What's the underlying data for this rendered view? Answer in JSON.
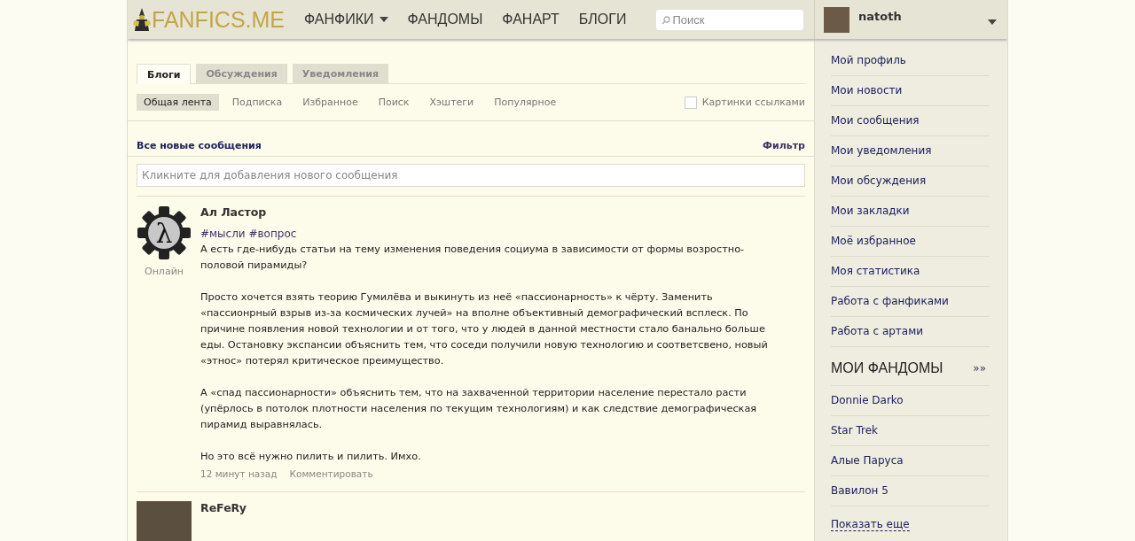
{
  "header": {
    "logo": "FANFICS.ME",
    "nav": [
      {
        "label": "ФАНФИКИ",
        "dropdown": true
      },
      {
        "label": "ФАНДОМЫ",
        "dropdown": false
      },
      {
        "label": "ФАНАРТ",
        "dropdown": false
      },
      {
        "label": "БЛОГИ",
        "dropdown": false
      }
    ],
    "search": {
      "placeholder": "Поиск"
    },
    "user": {
      "name": "natoth"
    }
  },
  "tabs": [
    {
      "label": "Блоги",
      "selected": true
    },
    {
      "label": "Обсуждения",
      "selected": false
    },
    {
      "label": "Уведомления",
      "selected": false
    }
  ],
  "subtabs": [
    {
      "label": "Общая лента",
      "selected": true
    },
    {
      "label": "Подписка",
      "selected": false
    },
    {
      "label": "Избранное",
      "selected": false
    },
    {
      "label": "Поиск",
      "selected": false
    },
    {
      "label": "Хэштеги",
      "selected": false
    },
    {
      "label": "Популярное",
      "selected": false
    }
  ],
  "images_as_links": {
    "label": "Картинки ссылками",
    "checked": false
  },
  "feed": {
    "title": "Все новые сообщения",
    "filter": "Фильтр",
    "new_post": {
      "placeholder": "Кликните для добавления нового сообщения"
    }
  },
  "posts": [
    {
      "author": "Ал Ластор",
      "avatar_symbol": "λ",
      "status": "Онлайн",
      "tags": "#мысли #вопрос",
      "paragraphs": [
        "А есть где-нибудь статьи на тему изменения поведения социума в зависимости от формы возростно-половой пирамиды?",
        "Просто хочется взять теорию Гумилёва и выкинуть из неё «пассионарность» к чёрту. Заменить «пассионрный взрыв из-за космических лучей» на вполне объективный демографический всплеск. По причине появления новой технологии и от того, что у людей в данной местности стало банально больше еды. Остановку экспансии объяснить тем, что соседи получили новую технологию и соответсвено, новый «этнос» потерял критическое преимущество.",
        "А «спад пассионарности» объяснить тем, что на захваченной территории население перестало расти (упёрлось в потолок плотности населения по текущим технологиям) и как следствие демографическая пирамид выравнялась.",
        "Но это всё нужно пилить и пилить. Имхо."
      ],
      "time": "12 минут назад",
      "comment": "Комментировать"
    },
    {
      "author": "ReFeRy"
    }
  ],
  "sidebar": {
    "links": [
      "Мой профиль",
      "Мои новости",
      "Мои сообщения",
      "Мои уведомления",
      "Мои обсуждения",
      "Мои закладки",
      "Моё избранное",
      "Моя статистика",
      "Работа с фанфиками",
      "Работа с артами"
    ],
    "fandoms_title": "МОИ ФАНДОМЫ",
    "fandoms_more": "»»",
    "fandoms": [
      "Donnie Darko",
      "Star Trek",
      "Алые Паруса",
      "Вавилон 5"
    ],
    "show_more": "Показать еще"
  }
}
